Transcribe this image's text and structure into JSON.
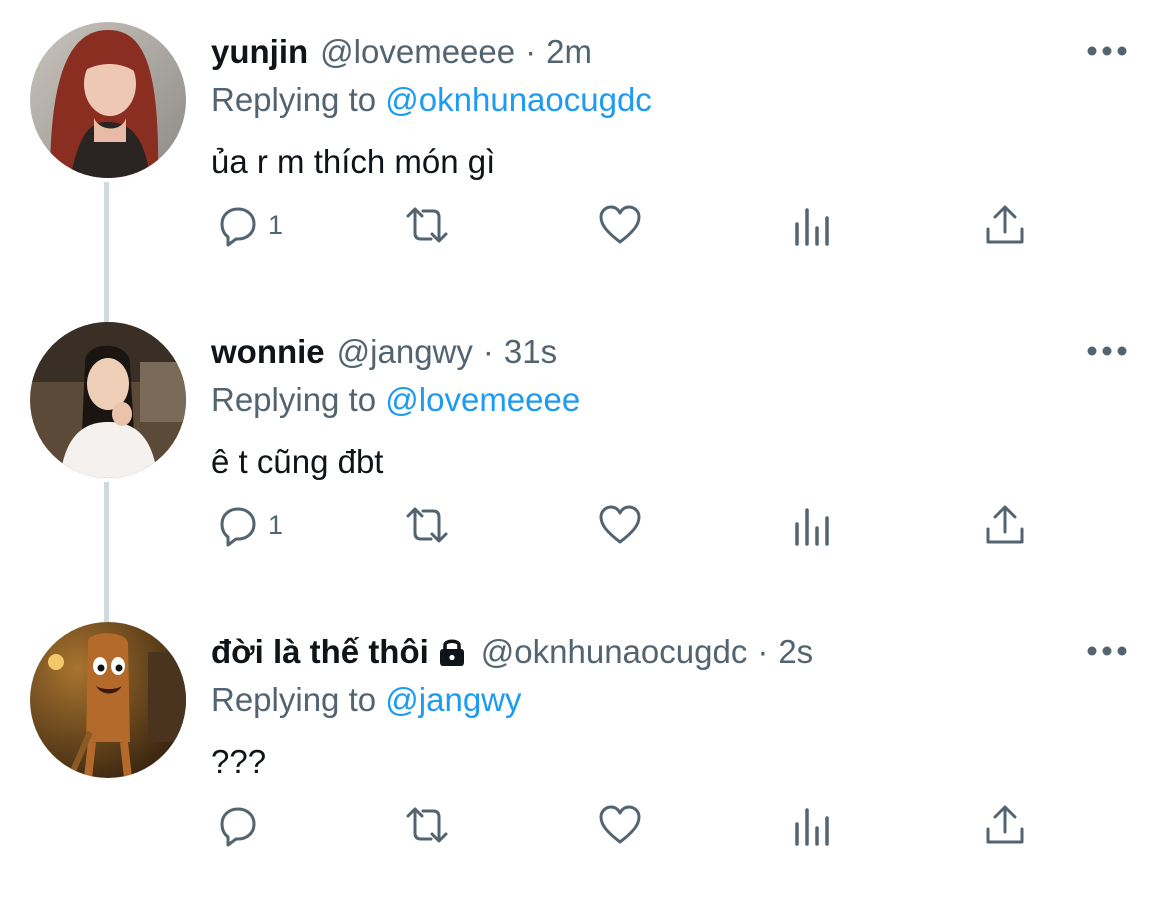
{
  "tweets": [
    {
      "name": "yunjin",
      "locked": false,
      "handle": "@lovemeeee",
      "time": "2m",
      "replying_prefix": "Replying to",
      "replying_to": "@oknhunaocugdc",
      "text": "ủa r m thích món gì",
      "reply_count": "1",
      "avatar": "woman-red-hair-photo"
    },
    {
      "name": "wonnie",
      "locked": false,
      "handle": "@jangwy",
      "time": "31s",
      "replying_prefix": "Replying to",
      "replying_to": "@lovemeeee",
      "text": "ê t cũng đbt",
      "reply_count": "1",
      "avatar": "woman-eating-photo"
    },
    {
      "name": "đời là thế thôi",
      "locked": true,
      "handle": "@oknhunaocugdc",
      "time": "2s",
      "replying_prefix": "Replying to",
      "replying_to": "@jangwy",
      "text": "???",
      "reply_count": "",
      "avatar": "wooden-creature-photo"
    }
  ],
  "separator": "·",
  "icons": [
    "reply-icon",
    "retweet-icon",
    "like-icon",
    "views-icon",
    "share-icon",
    "more-icon",
    "lock-icon"
  ],
  "colors": {
    "text": "#0f1419",
    "secondary": "#536471",
    "link": "#1d9bf0",
    "thread_line": "#cfd9de"
  }
}
